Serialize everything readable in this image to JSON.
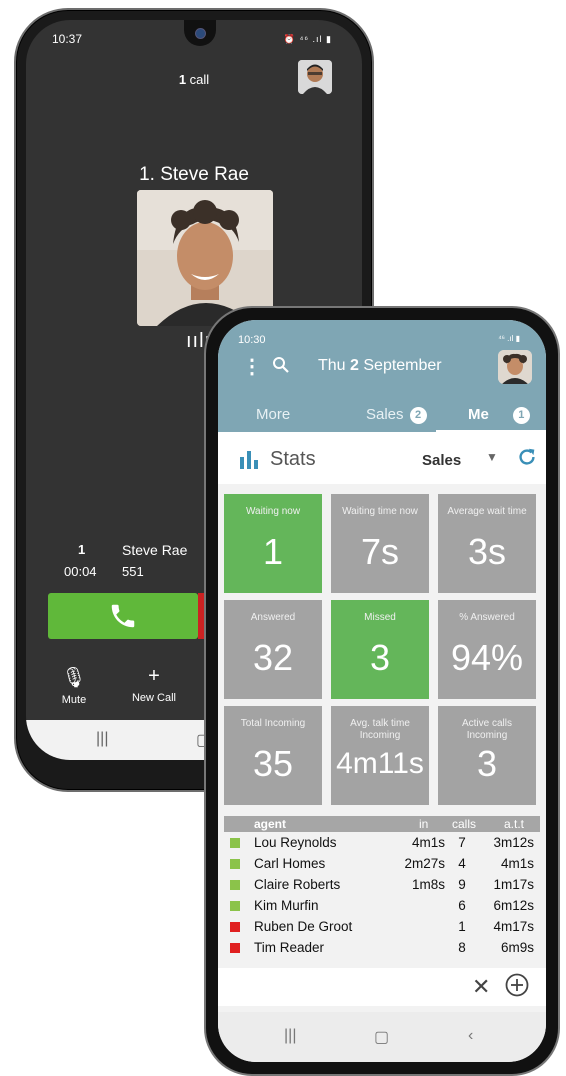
{
  "back_phone": {
    "status_time": "10:37",
    "status_icons": "⏰ ⁴⁶ .ıl ▮",
    "call_count_num": "1",
    "call_count_label": " call",
    "caller_heading": "1. Steve Rae",
    "line_number": "1",
    "call_timer": "00:04",
    "caller_name": "Steve Rae",
    "caller_ext": "551",
    "mute_label": "Mute",
    "new_call_label": "New Call"
  },
  "front_phone": {
    "status_time": "10:30",
    "status_icons": "⁴⁶ .ıl ▮",
    "date_prefix": "Thu ",
    "date_day": "2",
    "date_month": " September",
    "tabs": [
      {
        "label": "More",
        "badge": ""
      },
      {
        "label": "Sales",
        "badge": "2"
      },
      {
        "label": "Me",
        "badge": "1"
      }
    ],
    "stats_title": "Stats",
    "queue_select": "Sales",
    "tiles": [
      {
        "label": "Waiting now",
        "value": "1",
        "color": "green"
      },
      {
        "label": "Waiting time now",
        "value": "7s",
        "color": "grey"
      },
      {
        "label": "Average wait time",
        "value": "3s",
        "color": "grey"
      },
      {
        "label": "Answered",
        "value": "32",
        "color": "grey"
      },
      {
        "label": "Missed",
        "value": "3",
        "color": "green"
      },
      {
        "label": "% Answered",
        "value": "94%",
        "color": "grey"
      },
      {
        "label": "Total Incoming",
        "value": "35",
        "color": "grey"
      },
      {
        "label": "Avg. talk time\nIncoming",
        "value": "4m11s",
        "color": "grey"
      },
      {
        "label": "Active calls\nIncoming",
        "value": "3",
        "color": "grey"
      }
    ],
    "agents_header": {
      "agent": "agent",
      "in": "in",
      "calls": "calls",
      "att": "a.t.t"
    },
    "agents": [
      {
        "name": "Lou Reynolds",
        "in": "4m1s",
        "calls": "7",
        "att": "3m12s",
        "status": "#8bc34a"
      },
      {
        "name": "Carl Homes",
        "in": "2m27s",
        "calls": "4",
        "att": "4m1s",
        "status": "#8bc34a"
      },
      {
        "name": "Claire Roberts",
        "in": "1m8s",
        "calls": "9",
        "att": "1m17s",
        "status": "#8bc34a"
      },
      {
        "name": "Kim Murfin",
        "in": "",
        "calls": "6",
        "att": "6m12s",
        "status": "#8bc34a"
      },
      {
        "name": "Ruben De Groot",
        "in": "",
        "calls": "1",
        "att": "4m17s",
        "status": "#e02020"
      },
      {
        "name": "Tim Reader",
        "in": "",
        "calls": "8",
        "att": "6m9s",
        "status": "#e02020"
      }
    ]
  },
  "colors": {
    "header": "#7fa6b4",
    "green": "#64b65a",
    "grey_tile": "#a3a3a3",
    "answer": "#60b83a"
  }
}
